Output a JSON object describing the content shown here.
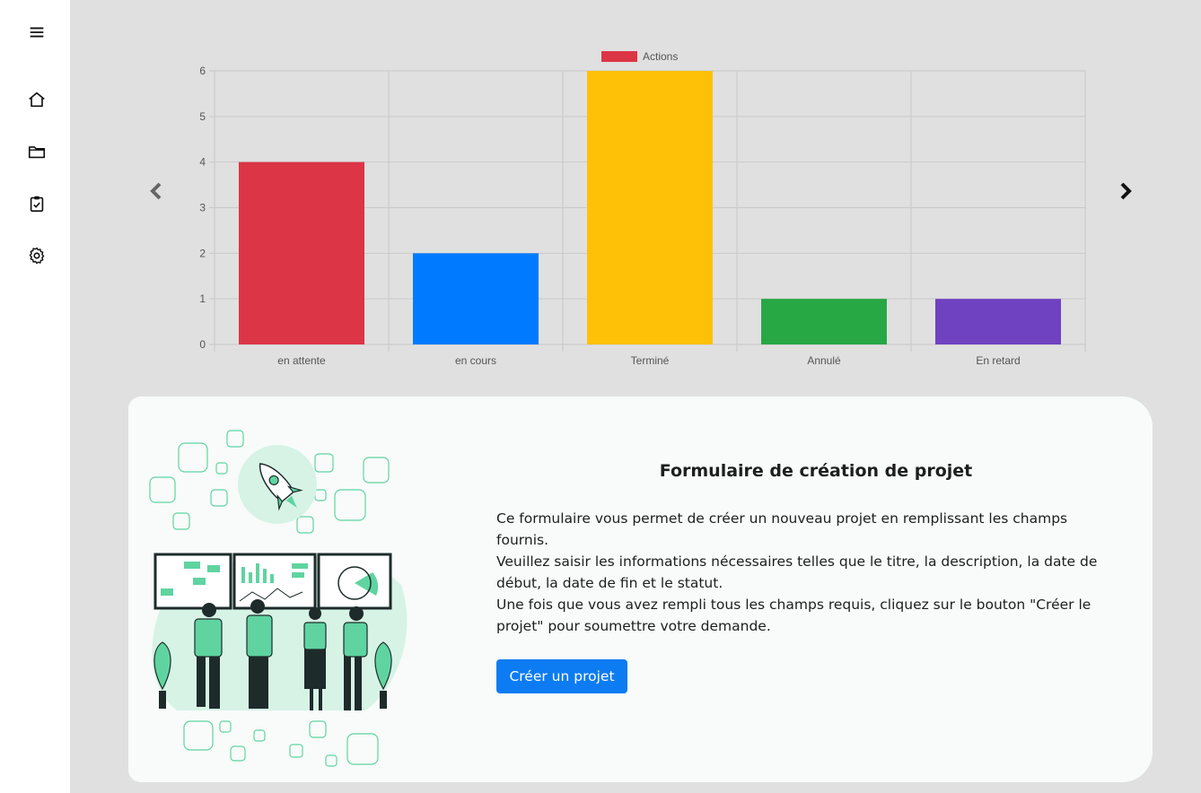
{
  "sidebar": {
    "items": [
      {
        "name": "menu",
        "icon": "hamburger-menu-icon"
      },
      {
        "name": "home",
        "icon": "home-icon"
      },
      {
        "name": "projects",
        "icon": "folder-icon"
      },
      {
        "name": "tasks",
        "icon": "clipboard-check-icon"
      },
      {
        "name": "settings",
        "icon": "gear-icon"
      }
    ]
  },
  "carousel": {
    "prev_icon": "chevron-left-icon",
    "next_icon": "chevron-right-icon"
  },
  "chart_data": {
    "type": "bar",
    "categories": [
      "en attente",
      "en cours",
      "Terminé",
      "Annulé",
      "En retard"
    ],
    "series": [
      {
        "name": "Actions",
        "values": [
          4,
          2,
          6,
          1,
          1
        ],
        "colors": [
          "#dc3545",
          "#007bff",
          "#ffc107",
          "#28a745",
          "#6f42c1"
        ]
      }
    ],
    "legend_color": "#dc3545",
    "ylim": [
      0,
      6
    ],
    "yticks": [
      0,
      1,
      2,
      3,
      4,
      5,
      6
    ],
    "grid": true,
    "legend_position": "top-center",
    "title": "",
    "xlabel": "",
    "ylabel": ""
  },
  "card": {
    "title": "Formulaire de création de projet",
    "paragraph1": "Ce formulaire vous permet de créer un nouveau projet en remplissant les champs fournis.",
    "paragraph2": "Veuillez saisir les informations nécessaires telles que le titre, la description, la date de début, la date de fin et le statut.",
    "paragraph3": "Une fois que vous avez rempli tous les champs requis, cliquez sur le bouton \"Créer le projet\" pour soumettre votre demande.",
    "button_label": "Créer un projet",
    "button_color": "#0d7cf2",
    "illustration": "team-dashboard-illustration"
  }
}
